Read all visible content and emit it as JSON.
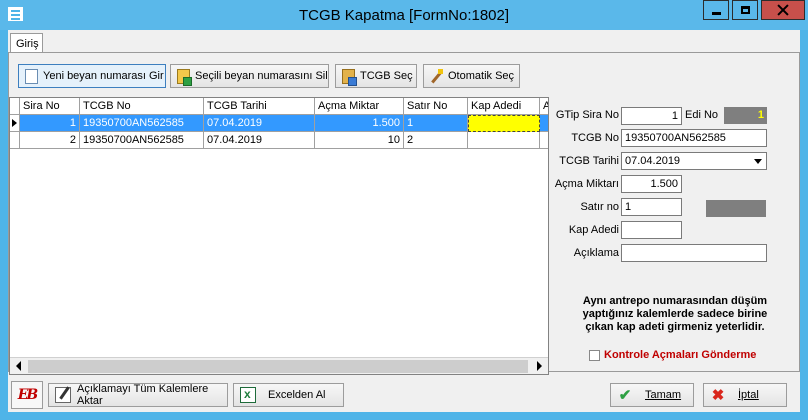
{
  "window": {
    "title": "TCGB Kapatma [FormNo:1802]",
    "minimize_glyph": "–",
    "maximize_glyph": "□",
    "close_glyph": "✕"
  },
  "tabs": [
    {
      "label": "Giriş"
    }
  ],
  "toolbar": {
    "new_number": "Yeni beyan numarası Gir",
    "selected_number": "Seçili beyan numarasını Sil",
    "tcgb_select": "TCGB Seç",
    "auto_select": "Otomatik Seç"
  },
  "grid": {
    "columns": [
      "Sira No",
      "TCGB No",
      "TCGB Tarihi",
      "Açma Miktar",
      "Satır No",
      "Kap Adedi",
      "A"
    ],
    "rows": [
      {
        "sira_no": "1",
        "tcgb_no": "19350700AN562585",
        "tcgb_tarihi": "07.04.2019",
        "acma_miktar": "1.500",
        "satir_no": "1",
        "kap_adedi": ""
      },
      {
        "sira_no": "2",
        "tcgb_no": "19350700AN562585",
        "tcgb_tarihi": "07.04.2019",
        "acma_miktar": "10",
        "satir_no": "2",
        "kap_adedi": ""
      }
    ]
  },
  "form": {
    "gtip_sira_no_label": "GTip Sira No",
    "gtip_sira_no_value": "1",
    "edi_no_label": "Edi No",
    "edi_no_value": "1",
    "tcgb_no_label": "TCGB No",
    "tcgb_no_value": "19350700AN562585",
    "tcgb_tarihi_label": "TCGB Tarihi",
    "tcgb_tarihi_value": "07.04.2019",
    "acma_miktari_label": "Açma Miktarı",
    "acma_miktari_value": "1.500",
    "satir_no_label": "Satır no",
    "satir_no_value": "1",
    "kap_adedi_label": "Kap Adedi",
    "kap_adedi_value": "",
    "aciklama_label": "Açıklama",
    "aciklama_value": ""
  },
  "note": {
    "line1": "Aynı antrepo numarasından düşüm",
    "line2": "yaptığınız kalemlerde sadece birine",
    "line3": "çıkan kap adeti girmeniz yeterlidir."
  },
  "checkbox": {
    "label": "Kontrole Açmaları Gönderme",
    "checked": false
  },
  "bottom": {
    "logo_text": "EB",
    "apply_all": "Açıklamayı Tüm Kalemlere Aktar",
    "excel": "Excelden Al",
    "ok": "Tamam",
    "cancel": "İptal"
  },
  "colors": {
    "titlebar": "#5ab8ea",
    "selection": "#3399ff",
    "highlight_cell": "#ffff00",
    "warning_text": "#c00000",
    "close_button": "#c7504b"
  }
}
